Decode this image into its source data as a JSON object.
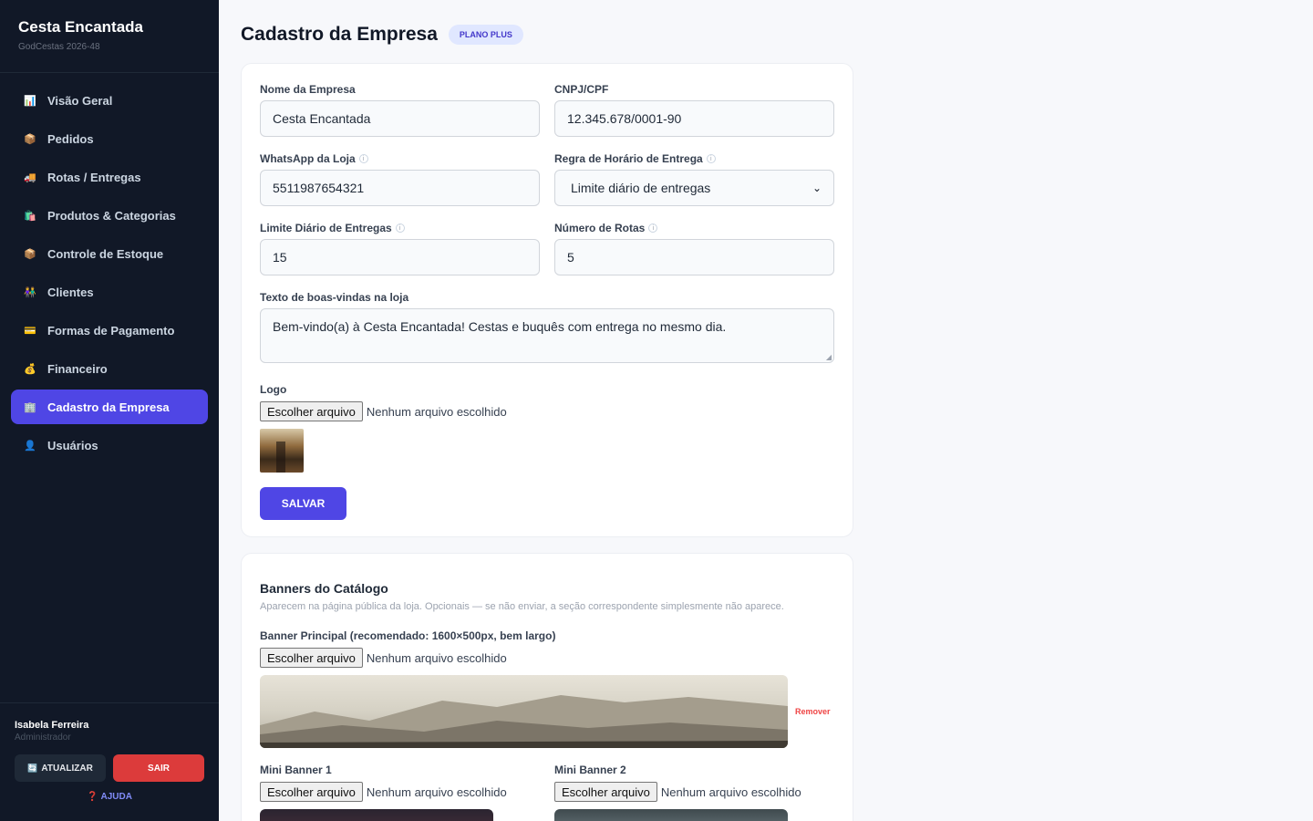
{
  "brand": {
    "title": "Cesta Encantada",
    "subtitle": "GodCestas 2026-48"
  },
  "nav": [
    {
      "label": "Visão Geral",
      "icon": "📊"
    },
    {
      "label": "Pedidos",
      "icon": "📦"
    },
    {
      "label": "Rotas / Entregas",
      "icon": "🚚"
    },
    {
      "label": "Produtos & Categorias",
      "icon": "🛍️"
    },
    {
      "label": "Controle de Estoque",
      "icon": "📦"
    },
    {
      "label": "Clientes",
      "icon": "👫"
    },
    {
      "label": "Formas de Pagamento",
      "icon": "💳"
    },
    {
      "label": "Financeiro",
      "icon": "💰"
    },
    {
      "label": "Cadastro da Empresa",
      "icon": "🏢"
    },
    {
      "label": "Usuários",
      "icon": "👤"
    }
  ],
  "user": {
    "name": "Isabela Ferreira",
    "role": "Administrador"
  },
  "footer": {
    "update_label": "ATUALIZAR",
    "update_icon": "🔄",
    "exit_label": "SAIR",
    "help_label": "AJUDA",
    "help_icon": "❓"
  },
  "page": {
    "title": "Cadastro da Empresa",
    "badge": "PLANO PLUS"
  },
  "form": {
    "company_name": {
      "label": "Nome da Empresa",
      "value": "Cesta Encantada"
    },
    "cnpj": {
      "label": "CNPJ/CPF",
      "value": "12.345.678/0001-90"
    },
    "whatsapp": {
      "label": "WhatsApp da Loja",
      "value": "5511987654321"
    },
    "delivery_rule": {
      "label": "Regra de Horário de Entrega",
      "value": "Limite diário de entregas"
    },
    "daily_limit": {
      "label": "Limite Diário de Entregas",
      "value": "15"
    },
    "routes": {
      "label": "Número de Rotas",
      "value": "5"
    },
    "welcome": {
      "label": "Texto de boas-vindas na loja",
      "value": "Bem-vindo(a) à Cesta Encantada! Cestas e buquês com entrega no mesmo dia."
    },
    "logo": {
      "label": "Logo"
    },
    "file_button": "Escolher arquivo",
    "file_none": "Nenhum arquivo escolhido",
    "save_label": "SALVAR"
  },
  "banners": {
    "title": "Banners do Catálogo",
    "description": "Aparecem na página pública da loja. Opcionais — se não enviar, a seção correspondente simplesmente não aparece.",
    "main_label": "Banner Principal (recomendado: 1600×500px, bem largo)",
    "remove_label": "Remover",
    "mini1_label": "Mini Banner 1",
    "mini2_label": "Mini Banner 2"
  },
  "colors": {
    "accent": "#4f46e5",
    "sidebar": "#111827",
    "danger": "#dc3b3b"
  }
}
